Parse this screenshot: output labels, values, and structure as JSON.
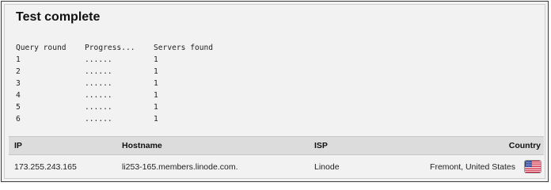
{
  "title": "Test complete",
  "query_table": {
    "headers": [
      "Query round",
      "Progress...",
      "Servers found"
    ],
    "rows": [
      {
        "round": "1",
        "progress": "......",
        "servers": "1"
      },
      {
        "round": "2",
        "progress": "......",
        "servers": "1"
      },
      {
        "round": "3",
        "progress": "......",
        "servers": "1"
      },
      {
        "round": "4",
        "progress": "......",
        "servers": "1"
      },
      {
        "round": "5",
        "progress": "......",
        "servers": "1"
      },
      {
        "round": "6",
        "progress": "......",
        "servers": "1"
      }
    ]
  },
  "results_table": {
    "headers": {
      "ip": "IP",
      "hostname": "Hostname",
      "isp": "ISP",
      "country": "Country"
    },
    "rows": [
      {
        "ip": "173.255.243.165",
        "hostname": "li253-165.members.linode.com.",
        "isp": "Linode",
        "country": "Fremont, United States",
        "flag_icon": "us-flag-icon"
      }
    ]
  },
  "colors": {
    "panel_background": "#f2f2f2",
    "header_background": "#dcdcdc",
    "border": "#3a3a3a"
  }
}
